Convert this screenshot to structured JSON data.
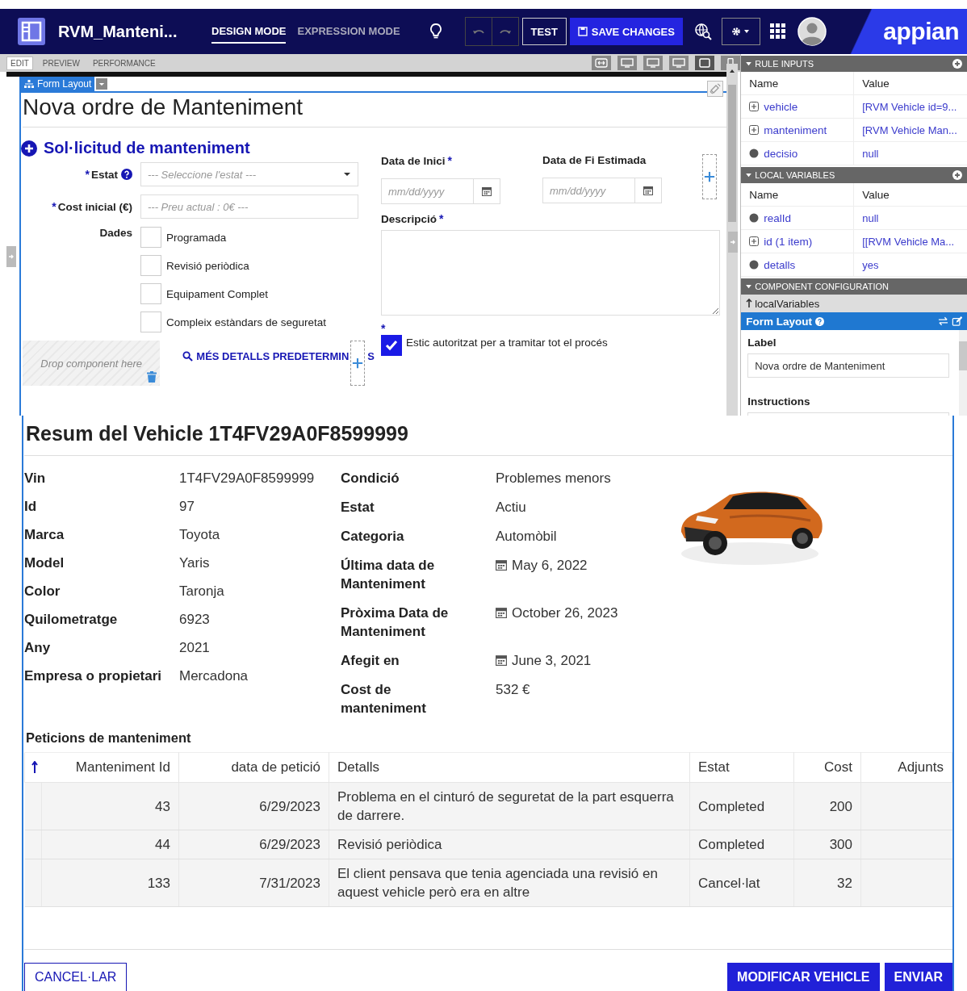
{
  "header": {
    "app_title": "RVM_Manteni...",
    "modes": [
      {
        "label": "DESIGN MODE",
        "selected": true
      },
      {
        "label": "EXPRESSION MODE",
        "selected": false
      }
    ],
    "test_button": "TEST",
    "save_button": "SAVE CHANGES",
    "logo": "appian"
  },
  "editor_tabs": [
    {
      "label": "EDIT",
      "selected": true
    },
    {
      "label": "PREVIEW",
      "selected": false
    },
    {
      "label": "PERFORMANCE",
      "selected": false
    }
  ],
  "form": {
    "layout_tag": "Form Layout",
    "title": "Nova ordre de Manteniment",
    "section_title": "Sol·licitud de manteniment",
    "estat": {
      "mark": "*",
      "label": "Estat",
      "placeholder": "--- Seleccione l'estat ---"
    },
    "cost": {
      "mark": "*",
      "label": "Cost inicial (€)",
      "placeholder": "--- Preu actual : 0€ ---"
    },
    "dades_label": "Dades",
    "checkboxes": [
      {
        "label": "Programada",
        "checked": false
      },
      {
        "label": "Revisió periòdica",
        "checked": false
      },
      {
        "label": "Equipament Complet",
        "checked": false
      },
      {
        "label": "Compleix estàndars de seguretat",
        "checked": false
      }
    ],
    "drop_zone": "Drop component here",
    "link_text": "MÉS DETALLS PREDETERMIN",
    "link_tail": "S",
    "start_date": {
      "label": "Data de Inici",
      "mark": "*",
      "placeholder": "mm/dd/yyyy"
    },
    "end_date": {
      "label": "Data de Fi Estimada",
      "placeholder": "mm/dd/yyyy"
    },
    "description": {
      "label": "Descripció",
      "mark": "*"
    },
    "authorization": {
      "mark": "*",
      "label": "Estic autoritzat per a tramitar tot el procés",
      "checked": true
    }
  },
  "panel": {
    "rule_inputs": {
      "title": "RULE INPUTS",
      "columns": [
        "Name",
        "Value"
      ],
      "rows": [
        {
          "kind": "expandable",
          "name": "vehicle",
          "value": "[RVM Vehicle id=9..."
        },
        {
          "kind": "expandable",
          "name": "manteniment",
          "value": "[RVM Vehicle Man..."
        },
        {
          "kind": "simple",
          "name": "decisio",
          "value": "null"
        }
      ]
    },
    "local_variables": {
      "title": "LOCAL VARIABLES",
      "columns": [
        "Name",
        "Value"
      ],
      "rows": [
        {
          "kind": "simple",
          "name": "realId",
          "value": "null"
        },
        {
          "kind": "expandable",
          "name": "id (1 item)",
          "value": "[[RVM Vehicle Ma..."
        },
        {
          "kind": "simple",
          "name": "detalls",
          "value": "yes"
        }
      ]
    },
    "component_configuration": {
      "title": "COMPONENT CONFIGURATION",
      "breadcrumb": "localVariables",
      "selected_component": "Form Layout",
      "label_heading": "Label",
      "label_value": "Nova ordre de Manteniment",
      "instructions_heading": "Instructions"
    }
  },
  "summary": {
    "title": "Resum del Vehicle 1T4FV29A0F8599999",
    "left": [
      {
        "label": "Vin",
        "value": "1T4FV29A0F8599999"
      },
      {
        "label": "Id",
        "value": "97"
      },
      {
        "label": "Marca",
        "value": "Toyota"
      },
      {
        "label": "Model",
        "value": "Yaris"
      },
      {
        "label": "Color",
        "value": "Taronja"
      },
      {
        "label": "Quilometratge",
        "value": "6923"
      },
      {
        "label": "Any",
        "value": "2021"
      },
      {
        "label": "Empresa o propietari",
        "value": "Mercadona"
      }
    ],
    "right": [
      {
        "kind": "text",
        "label": "Condició",
        "value": "Problemes menors"
      },
      {
        "kind": "text",
        "label": "Estat",
        "value": "Actiu"
      },
      {
        "kind": "text",
        "label": "Categoria",
        "value": "Automòbil"
      },
      {
        "kind": "date",
        "label": "Última data de Manteniment",
        "value": "May 6, 2022"
      },
      {
        "kind": "date",
        "label": "Pròxima Data de Manteniment",
        "value": "October 26, 2023"
      },
      {
        "kind": "date",
        "label": "Afegit en",
        "value": "June 3, 2021"
      },
      {
        "kind": "text",
        "label": "Cost de manteniment",
        "value": "532 €"
      }
    ]
  },
  "requests": {
    "title": "Peticions de manteniment",
    "columns": [
      "Manteniment Id",
      "data de petició",
      "Detalls",
      "Estat",
      "Cost",
      "Adjunts"
    ],
    "rows": [
      {
        "id": "43",
        "date": "6/29/2023",
        "details": "Problema en el cinturó de seguretat de la part esquerra de darrere.",
        "status": "Completed",
        "cost": "200"
      },
      {
        "id": "44",
        "date": "6/29/2023",
        "details": "Revisió periòdica",
        "status": "Completed",
        "cost": "300"
      },
      {
        "id": "133",
        "date": "7/31/2023",
        "details": "El client pensava que tenia agenciada una revisió en aquest vehicle però era en altre",
        "status": "Cancel·lat",
        "cost": "32"
      }
    ]
  },
  "buttons": {
    "cancel": "CANCEL·LAR",
    "modify": "MODIFICAR VEHICLE",
    "submit": "ENVIAR"
  }
}
